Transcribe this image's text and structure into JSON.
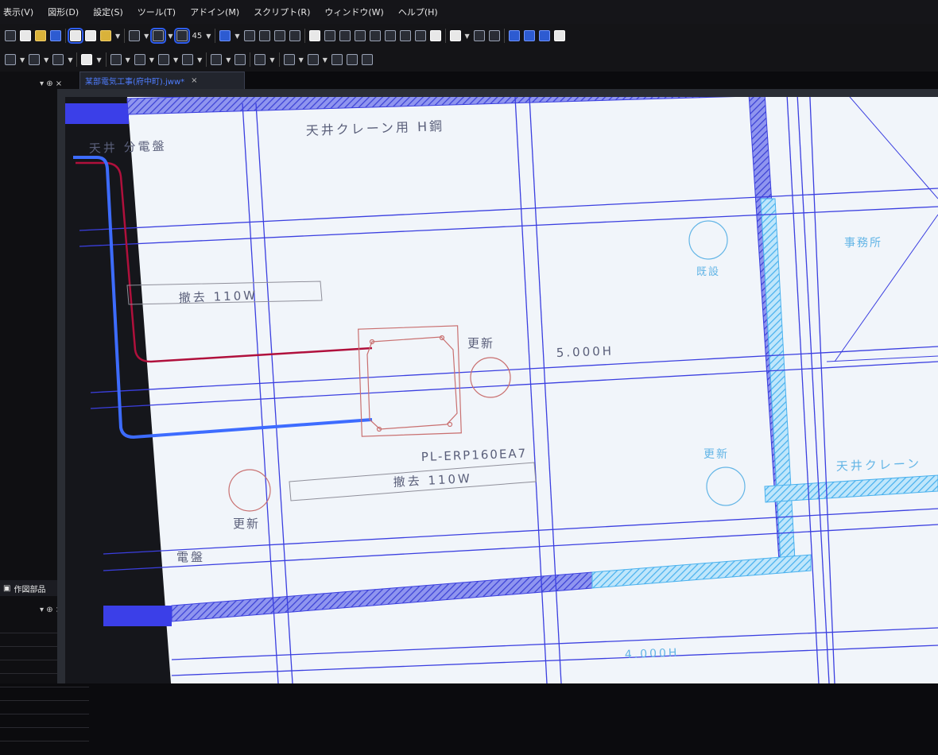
{
  "menu": {
    "items": [
      "表示(V)",
      "図形(D)",
      "設定(S)",
      "ツール(T)",
      "アドイン(M)",
      "スクリプト(R)",
      "ウィンドウ(W)",
      "ヘルプ(H)"
    ]
  },
  "toolbar": {
    "angle_value": "45"
  },
  "document_tab": {
    "title": "某部電気工事(府中町).jww*",
    "close": "×"
  },
  "side_panel": {
    "controls": "▾ ⊕ ×",
    "tab_label": "作図部品",
    "controls2": "▾ ⊕ ×"
  },
  "drawing": {
    "labels": {
      "crane_h_beam": "天井クレーン用 H鋼",
      "branch_panel": "天井 分電盤",
      "removal_1": "撤去 110W",
      "removal_2": "撤去 110W",
      "renew_1": "更新",
      "renew_2": "更新",
      "renew_3": "更新",
      "height_1": "5.000H",
      "fixture_model": "PL-ERP160EA7",
      "existing": "既設",
      "office": "事務所",
      "crane_right": "天井クレーン",
      "panel_bottom": "電盤",
      "height_2": "4.000H"
    },
    "colors": {
      "grid_line": "#3b3fe0",
      "hatch_dark": "#4a4fd8",
      "hatch_light": "#6cc3f2",
      "wire_blue": "#3d6cff",
      "wire_red": "#b0103c",
      "fixture": "#c97070",
      "text_dark": "#5a5f7a",
      "text_light": "#63b5e6"
    }
  }
}
